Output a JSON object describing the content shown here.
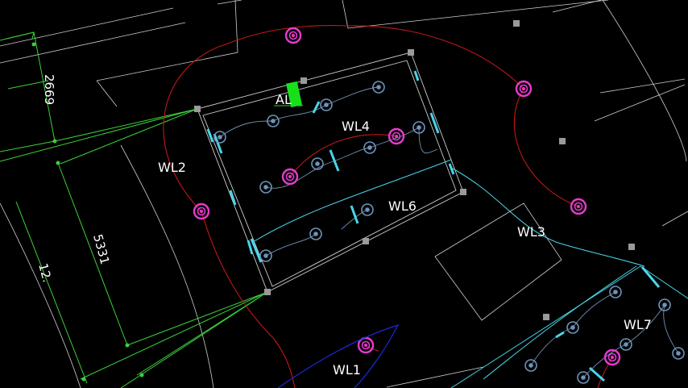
{
  "colors": {
    "background": "#000000",
    "outline": "#d0d0d0",
    "dimension": "#3ad13a",
    "feeder_red": "#c01818",
    "feeder_cyan": "#48d6e8",
    "lamp_blue": "#6f93b8",
    "fixture_magenta": "#e83ad0",
    "boundary_blue": "#1a2ad8",
    "panel_green": "#18e018",
    "post_gray": "#9a9a9a",
    "label_white": "#ffffff"
  },
  "icons": {
    "light_fixture": "double-ring-magenta-icon",
    "lamp": "ring-blue-icon",
    "panel": "green-box-icon",
    "post": "gray-square-icon"
  },
  "labels": {
    "panel": "AL",
    "wl1": "WL1",
    "wl2": "WL2",
    "wl3": "WL3",
    "wl4": "WL4",
    "wl6": "WL6",
    "wl7": "WL7"
  },
  "dimensions": {
    "d1": "2669",
    "d2": "5331",
    "d3": "12."
  }
}
